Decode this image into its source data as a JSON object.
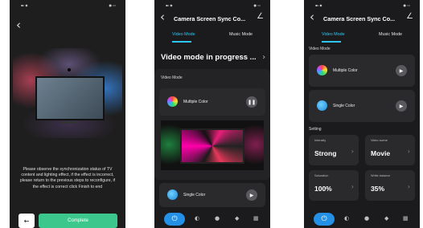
{
  "screen1": {
    "instructions": "Please observe the synchronization status of TV content and lighting effect, if the effect is incorrect, please return to the previous steps to reconfigure, if the effect is correct click Finish to end",
    "back_icon": "chevron-left",
    "prev_icon": "arrow-left",
    "complete_label": "Complete",
    "accent_color": "#3cc88c"
  },
  "screen2": {
    "title": "Camera Screen Sync Co...",
    "tabs": [
      "Video Mode",
      "Music Mode"
    ],
    "active_tab": "Video Mode",
    "status_heading": "Video mode in progress ...",
    "section_label": "Video Mode",
    "modes": [
      {
        "name": "Multiple Color",
        "control": "pause"
      },
      {
        "name": "Single Color",
        "control": "play"
      }
    ]
  },
  "screen3": {
    "title": "Camera Screen Sync Co...",
    "tabs": [
      "Video Mode",
      "Music Mode"
    ],
    "active_tab": "Video Mode",
    "section_label": "Video Mode",
    "modes": [
      {
        "name": "Multiple Color",
        "control": "play"
      },
      {
        "name": "Single Color",
        "control": "play"
      }
    ],
    "settings_label": "Setting",
    "settings": [
      {
        "label": "Intensity",
        "value": "Strong"
      },
      {
        "label": "Video scene",
        "value": "Movie"
      },
      {
        "label": "Saturation",
        "value": "100%"
      },
      {
        "label": "White balance",
        "value": "35%"
      }
    ]
  },
  "accent_color": "#2490e6",
  "tab_active_color": "#2ec7f5"
}
